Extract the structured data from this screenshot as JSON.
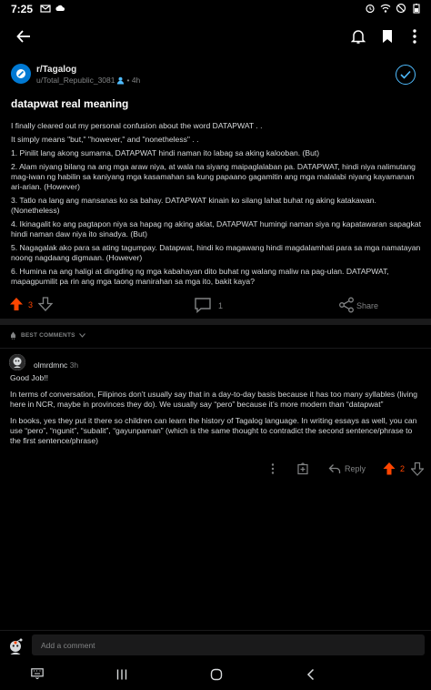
{
  "status_bar": {
    "time": "7:25"
  },
  "post": {
    "subreddit": "r/Tagalog",
    "author": "u/Total_Republic_3081",
    "age": "• 4h",
    "title": "datapwat real meaning",
    "body": [
      "I finally cleared out my personal confusion about the word DATAPWAT . .",
      "It simply means \"but,\" \"however,\" and \"nonetheless\" . .",
      "1. Pinilit lang akong sumama, DATAPWAT hindi naman ito labag sa aking kalooban. (But)",
      "2. Alam niyang bilang na ang mga araw niya, at wala na siyang maipaglalaban pa. DATAPWAT, hindi niya nalimutang mag-iwan ng habilin sa kaniyang mga kasamahan sa kung papaano gagamitin ang mga malalabi niyang kayamanan ari-arian. (However)",
      "3. Tatlo na lang ang mansanas ko sa bahay. DATAPWAT kinain ko silang lahat buhat ng aking katakawan. (Nonetheless)",
      "4. Ikinagalit ko ang pagtapon niya sa hapag ng aking aklat, DATAPWAT humingi naman siya ng kapatawaran sapagkat hindi naman daw niya ito sinadya. (But)",
      "5. Nagagalak ako para sa ating tagumpay. Datapwat, hindi ko magawang hindi magdalamhati para sa mga namatayan noong nagdaang digmaan. (However)",
      "6. Humina na ang haligi at dingding ng mga kabahayan dito buhat ng walang maliw na pag-ulan. DATAPWAT, mapagpumilit pa rin ang mga taong manirahan sa mga ito, bakit kaya?"
    ],
    "votes": "3",
    "comments": "1",
    "share_label": "Share"
  },
  "sort": {
    "label": "BEST COMMENTS"
  },
  "comment": {
    "user": "olmrdmnc",
    "age": "3h",
    "body": [
      "Good Job!!",
      "In terms of conversation, Filipinos don’t usually say that in a day-to-day basis because it has too many syllables (living here in NCR, maybe in provinces they do). We usually say “pero” because it’s more modern than “datapwat”",
      "In books, yes they put it there so children can learn the history of Tagalog language. In writing essays as well, you can use “pero”, “ngunit”, “subalit”, “gayunpaman” (which is the same thought to contradict the second sentence/phrase to the first sentence/phrase)"
    ],
    "reply_label": "Reply",
    "votes": "2"
  },
  "compose": {
    "placeholder": "Add a comment"
  },
  "colors": {
    "upvote": "#ff4500",
    "accent": "#4fbcff",
    "background": "#000000",
    "surface": "#1a1a1b"
  }
}
